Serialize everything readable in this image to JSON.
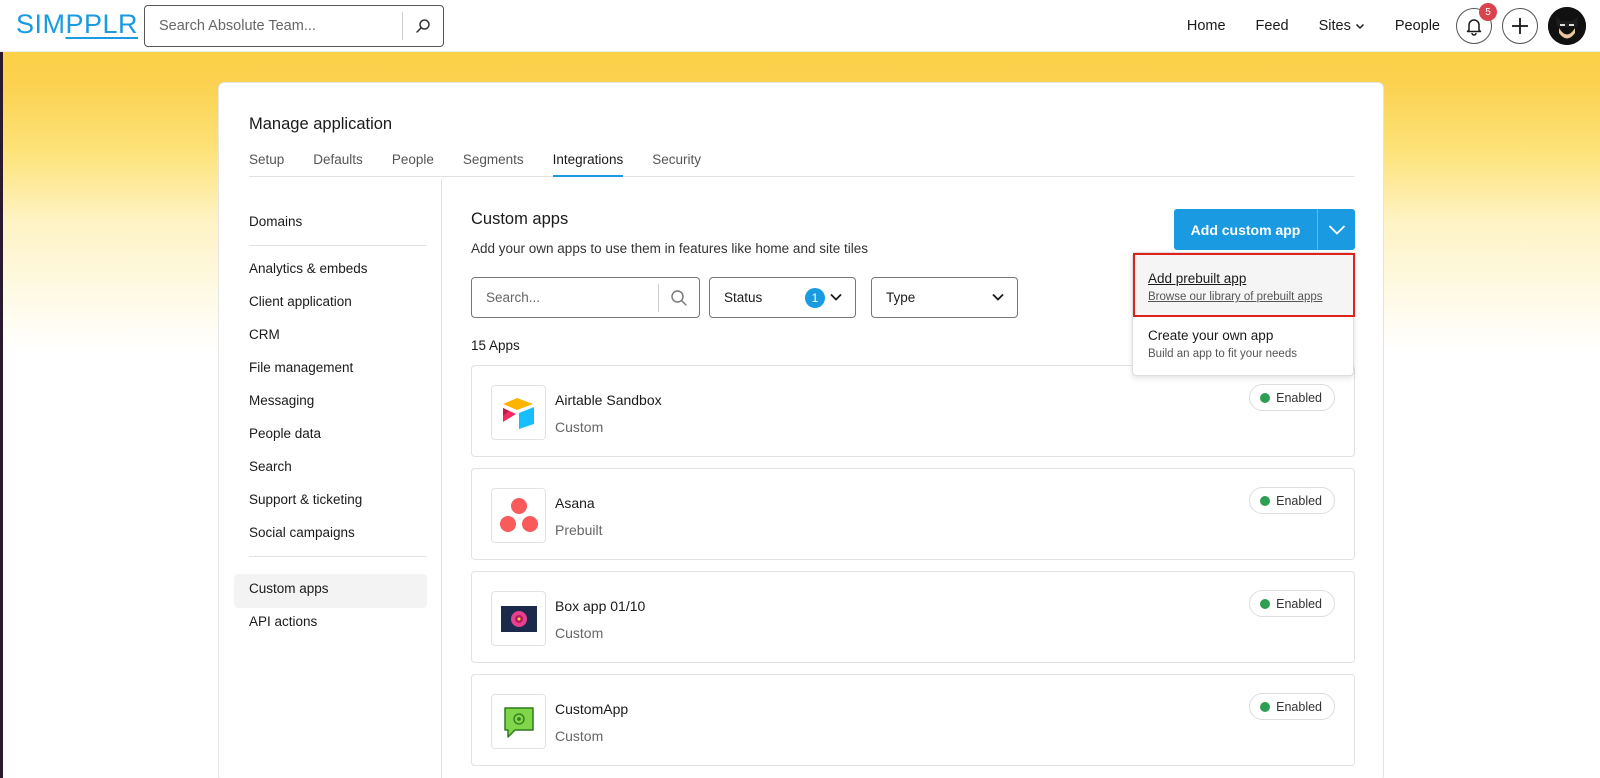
{
  "header": {
    "logo": {
      "part1": "SIM",
      "part2": "PPLR"
    },
    "search_placeholder": "Search Absolute Team...",
    "nav": {
      "home": "Home",
      "feed": "Feed",
      "sites": "Sites",
      "people": "People"
    },
    "notification_count": "5"
  },
  "card": {
    "title": "Manage application",
    "tabs": [
      "Setup",
      "Defaults",
      "People",
      "Segments",
      "Integrations",
      "Security"
    ],
    "active_tab": "Integrations"
  },
  "sidebar": {
    "items": [
      "Domains",
      "Analytics & embeds",
      "Client application",
      "CRM",
      "File management",
      "Messaging",
      "People data",
      "Search",
      "Support & ticketing",
      "Social campaigns",
      "Custom apps",
      "API actions"
    ],
    "active": "Custom apps"
  },
  "main": {
    "title": "Custom apps",
    "subtitle": "Add your own apps to use them in features like home and site tiles",
    "add_button": "Add custom app",
    "search_placeholder": "Search...",
    "status_filter": {
      "label": "Status",
      "count": "1"
    },
    "type_filter": {
      "label": "Type"
    },
    "apps_count": "15 Apps",
    "apps": [
      {
        "name": "Airtable Sandbox",
        "type": "Custom",
        "status": "Enabled"
      },
      {
        "name": "Asana",
        "type": "Prebuilt",
        "status": "Enabled"
      },
      {
        "name": "Box app 01/10",
        "type": "Custom",
        "status": "Enabled"
      },
      {
        "name": "CustomApp",
        "type": "Custom",
        "status": "Enabled"
      }
    ]
  },
  "dropdown": {
    "items": [
      {
        "title": "Add prebuilt app",
        "subtitle": "Browse our library of prebuilt apps"
      },
      {
        "title": "Create your own app",
        "subtitle": "Build an app to fit your needs"
      }
    ]
  },
  "colors": {
    "brand": "#1a9ae0",
    "banner": "#fbd148",
    "enabled": "#2e9e52",
    "badge": "#d9434e",
    "highlight": "#e0221c"
  }
}
